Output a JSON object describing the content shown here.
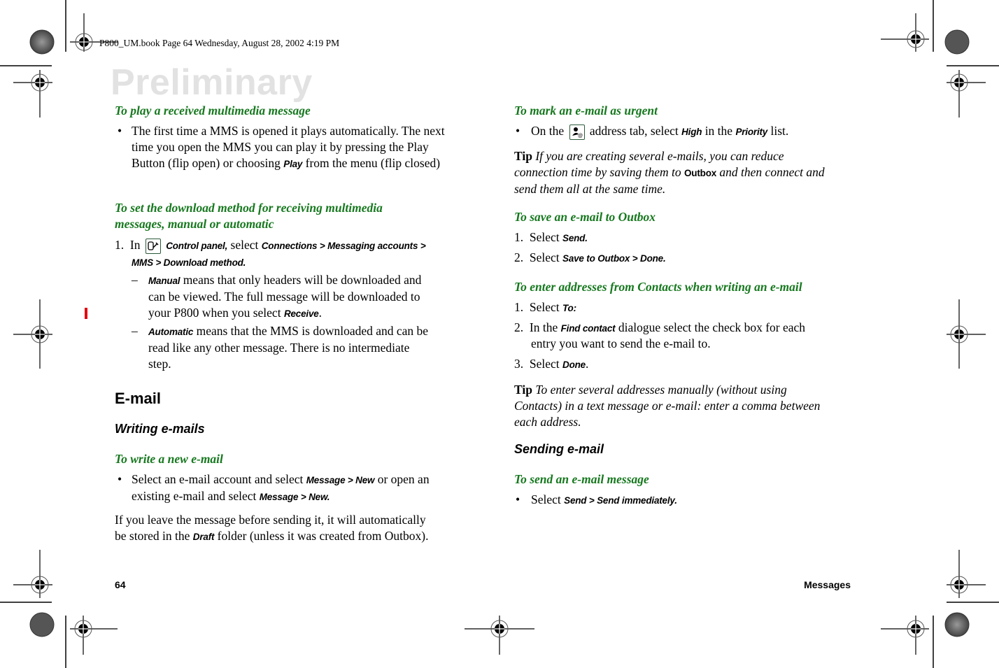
{
  "print_header": "P800_UM.book  Page 64  Wednesday, August 28, 2002  4:19 PM",
  "watermark": "Preliminary",
  "left_column": {
    "play_mms": {
      "heading": "To play a received multimedia message",
      "bullet": "•",
      "text_1": "The first time a MMS is opened it plays automatically. The next time you open the MMS you can play it by pressing the Play Button (flip open) or choosing ",
      "ui_play": "Play",
      "text_2": " from the menu (flip closed)"
    },
    "download_method": {
      "heading_line1": "To set the download method for receiving multimedia",
      "heading_line2": "messages, manual or automatic",
      "step_num": "1.",
      "step_in": "In",
      "icon": "control-panel-icon",
      "ui_control_panel": "Control panel,",
      "step_select": " select ",
      "ui_path_1": "Connections > Messaging accounts >",
      "ui_path_2": "MMS > Download method.",
      "dash": "–",
      "manual_ui": "Manual",
      "manual_text_1": " means that only headers will be downloaded and",
      "manual_text_2": "can be viewed. The full message will be downloaded to",
      "manual_text_3": "your P800 when you select ",
      "manual_ui_receive": "Receive",
      "manual_text_end": ".",
      "automatic_ui": "Automatic",
      "automatic_text_1": " means that the MMS is downloaded and can be",
      "automatic_text_2": "read like any other message. There is no intermediate",
      "automatic_text_3": "step."
    },
    "email_title": "E-mail",
    "writing_title": "Writing e-mails",
    "write_new": {
      "heading": "To write a new e-mail",
      "bullet": "•",
      "text_1": "Select an e-mail account and select ",
      "ui_1": "Message > New",
      "text_2": " or open an",
      "text_3": "existing e-mail and select ",
      "ui_2": "Message > New."
    },
    "draft_para": {
      "text_1": "If you leave the message before sending it, it will automatically",
      "text_2": "be stored in the ",
      "ui_draft": "Draft",
      "text_3": " folder (unless it was created from Outbox)."
    }
  },
  "right_column": {
    "urgent": {
      "heading": "To mark an e-mail as urgent",
      "bullet": "•",
      "text_1": "On the",
      "icon": "address-tab-icon",
      "text_2": " address tab, select ",
      "ui_high": "High",
      "text_3": " in the ",
      "ui_priority": "Priority",
      "text_4": " list."
    },
    "tip1": {
      "label": "Tip",
      "text_1": " If you are creating several e-mails, you can reduce",
      "text_2": "connection time by saving them to ",
      "ui_outbox": "Outbox",
      "text_3": " and then connect and",
      "text_4": "send them all at the same time."
    },
    "save_outbox": {
      "heading": "To save an e-mail to Outbox",
      "steps": [
        {
          "num": "1.",
          "text": "Select ",
          "ui": "Send."
        },
        {
          "num": "2.",
          "text": "Select ",
          "ui": "Save to Outbox > Done."
        }
      ]
    },
    "addresses": {
      "heading": "To enter addresses from Contacts when writing an e-mail",
      "step1_num": "1.",
      "step1_text": "Select ",
      "step1_ui": "To:",
      "step2_num": "2.",
      "step2_text_1": "In the ",
      "step2_ui": "Find contact",
      "step2_text_2": " dialogue select the check box for each",
      "step2_text_3": "entry you want to send the e-mail to.",
      "step3_num": "3.",
      "step3_text": "Select ",
      "step3_ui": "Done",
      "step3_end": "."
    },
    "tip2": {
      "label": "Tip",
      "text_1": " To enter several addresses manually (without using",
      "text_2": "Contacts) in a text message or e-mail: enter a comma between",
      "text_3": "each address."
    },
    "sending_title": "Sending e-mail",
    "send_msg": {
      "heading": "To send an e-mail message",
      "bullet": "•",
      "text": "Select ",
      "ui": "Send > Send immediately."
    }
  },
  "footer": {
    "page_number": "64",
    "section": "Messages"
  },
  "colors": {
    "heading_green": "#16781e",
    "change_bar": "#e0000e",
    "watermark": "#e2e2e2"
  }
}
